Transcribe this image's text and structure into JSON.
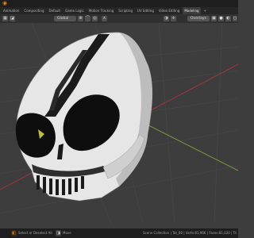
{
  "tabs": [
    "Animation",
    "Compositing",
    "Default",
    "Game Logic",
    "Motion Tracking",
    "Scripting",
    "UV Editing",
    "Video Editing",
    "Modeling",
    "+"
  ],
  "active_tab": "Modeling",
  "header": {
    "orientation": "Global",
    "overlays": "Overlays",
    "object_label": "Object",
    "selectability": "Selectability"
  },
  "status": {
    "select_hint": "Select or Deselect All",
    "move_hint": "Move",
    "scene_info": "Scene Collection | Tot_00 | Verts:81,966 | Faces:81,020 | Tris:16"
  },
  "colors": {
    "accent": "#e87d0d",
    "background": "#3d3d3d",
    "mask_white": "#eaeaea",
    "eye_black": "#101010",
    "grid_red": "#b0343e",
    "grid_green": "#7ea63f"
  }
}
